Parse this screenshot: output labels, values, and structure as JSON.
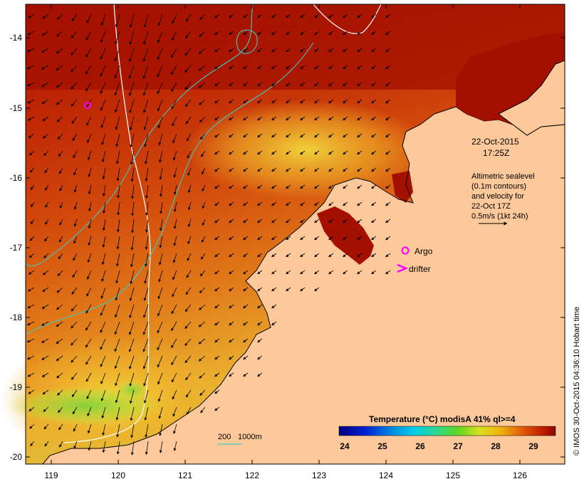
{
  "map": {
    "date_line1": "22-Oct-2015",
    "date_line2": "17:25Z",
    "legend_text": [
      "Altimetric sealevel",
      "(0.1m contours)",
      "and velocity for",
      "22-Oct 17Z",
      "0.5m/s (1kt 24h)"
    ],
    "argo_label": "Argo",
    "drifter_label": "drifter",
    "depth_label_200": "200",
    "depth_label_1000": "1000m",
    "credit": "© IMOS 30-Oct-2015 04:36:10 Hobart time",
    "colorbar_title": "Temperature (°C) modisA 41% ql>=4",
    "colorbar_ticks": [
      "24",
      "25",
      "26",
      "27",
      "28",
      "29"
    ],
    "lat_ticks": [
      "-14",
      "-15",
      "-16",
      "-17",
      "-18",
      "-19",
      "-20"
    ],
    "lon_ticks": [
      "119",
      "120",
      "121",
      "122",
      "123",
      "124",
      "125",
      "126"
    ],
    "colors": {
      "land": "#fdc89a",
      "warm": "#a31000",
      "mid": "#d94b10",
      "cool": "#e8a02a",
      "coolest": "#8fd02a",
      "isobath": "#3fc9c0",
      "contour": "#ffffff",
      "marker": "#ff00ff"
    }
  }
}
